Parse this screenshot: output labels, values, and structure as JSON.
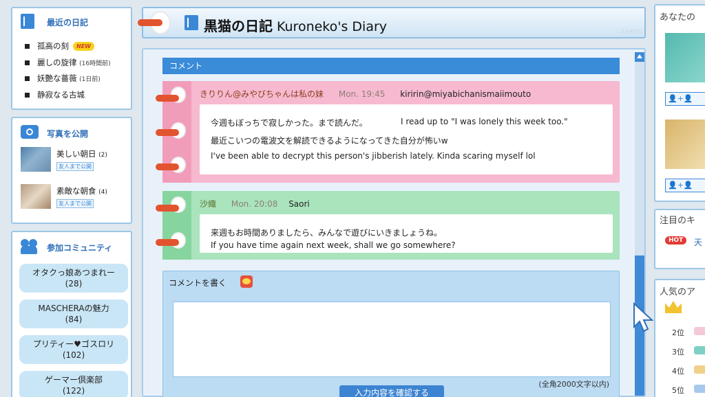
{
  "header": {
    "title_jp": "黒猫の日記",
    "title_en": "Kuroneko's Diary",
    "watermark": "TOKYO"
  },
  "sidebar": {
    "recent_diary": {
      "title": "最近の日記",
      "items": [
        {
          "label": "孤高の刻",
          "badge": "NEW",
          "note": ""
        },
        {
          "label": "麗しの旋律",
          "badge": "",
          "note": "(16時間前)"
        },
        {
          "label": "妖艶な薔薇",
          "badge": "",
          "note": "(1日前)"
        },
        {
          "label": "静寂なる古城",
          "badge": "",
          "note": ""
        }
      ]
    },
    "photos": {
      "title": "写真を公開",
      "items": [
        {
          "label": "美しい朝日",
          "count": "(2)",
          "visibility": "友人まで公開"
        },
        {
          "label": "素敵な朝食",
          "count": "(4)",
          "visibility": "友人まで公開"
        }
      ]
    },
    "communities": {
      "title": "参加コミュニティ",
      "items": [
        {
          "name": "オタクっ娘あつまれー",
          "count": "(28)"
        },
        {
          "name": "MASCHERAの魅力",
          "count": "(84)"
        },
        {
          "name": "プリティー♥ゴスロリ",
          "count": "(102)"
        },
        {
          "name": "ゲーマー倶楽部",
          "count": "(122)"
        }
      ]
    }
  },
  "main": {
    "comment_header": "コメント",
    "comments": [
      {
        "author": "きりりん@みやびちゃんは私の妹",
        "time": "Mon. 19:45",
        "author_en": "kiririn@miyabichanismaiimouto",
        "lines": [
          "今週もぼっちで寂しかった。まで読んだ。",
          "I read up to \"I was lonely this week too.\"",
          "最近こいつの電波文を解読できるようになってきた自分が怖いw",
          "I've been able to decrypt this person's jibberish lately. Kinda scaring myself lol"
        ]
      },
      {
        "author": "沙織",
        "time": "Mon. 20:08",
        "author_en": "Saori",
        "lines": [
          "来週もお時間ありましたら、みんなで遊びにいきましょうね。",
          "If you have time again next week, shall we go somewhere?"
        ]
      }
    ],
    "write": {
      "title": "コメントを書く",
      "value": "",
      "char_limit": "(全角2000文字以内)",
      "confirm_label": "入力内容を確認する"
    }
  },
  "right_sidebar": {
    "panel1_title": "あなたの",
    "add_btn_label": "👤+👤",
    "panel2_title": "注目のキ",
    "hot_label": "HOT",
    "hot_text": "天",
    "panel3_title": "人気のア",
    "ranks": [
      "2位",
      "3位",
      "4位",
      "5位"
    ]
  },
  "colors": {
    "accent_blue": "#3a8bd8",
    "comment_pink": "#f6b9cf",
    "comment_green": "#a9e4bd",
    "ring_orange": "#e2542f"
  }
}
